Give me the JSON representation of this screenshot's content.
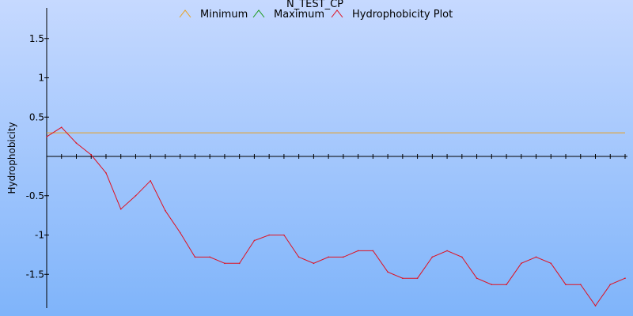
{
  "chart_data": {
    "type": "line",
    "title": "N_TEST_CP",
    "ylabel": "Hydrophobicity",
    "xlabel": "",
    "ylim": [
      -1.9,
      1.9
    ],
    "yticks": [
      1.5,
      1,
      0.5,
      -0.5,
      -1,
      -1.5
    ],
    "ytick_labels": [
      "1.5",
      "1",
      "0.5",
      "-0.5",
      "-1",
      "-1.5"
    ],
    "x_count": 40,
    "legend_position": "top",
    "background": {
      "top": "#c6d9ff",
      "bottom": "#7fb4fa"
    },
    "series": [
      {
        "name": "Minimum",
        "color": "#e8a020",
        "values": [
          0.3,
          0.3
        ]
      },
      {
        "name": "Maximum",
        "color": "#1a9a1a",
        "values": []
      },
      {
        "name": "Hydrophobicity Plot",
        "color": "#e01020",
        "values": [
          0.25,
          0.37,
          0.17,
          0.02,
          -0.21,
          -0.67,
          -0.5,
          -0.31,
          -0.69,
          -0.97,
          -1.28,
          -1.28,
          -1.36,
          -1.36,
          -1.07,
          -1.0,
          -1.0,
          -1.28,
          -1.36,
          -1.28,
          -1.28,
          -1.2,
          -1.2,
          -1.47,
          -1.55,
          -1.55,
          -1.28,
          -1.2,
          -1.28,
          -1.55,
          -1.63,
          -1.63,
          -1.36,
          -1.28,
          -1.36,
          -1.63,
          -1.63,
          -1.9,
          -1.63,
          -1.55
        ]
      }
    ]
  }
}
